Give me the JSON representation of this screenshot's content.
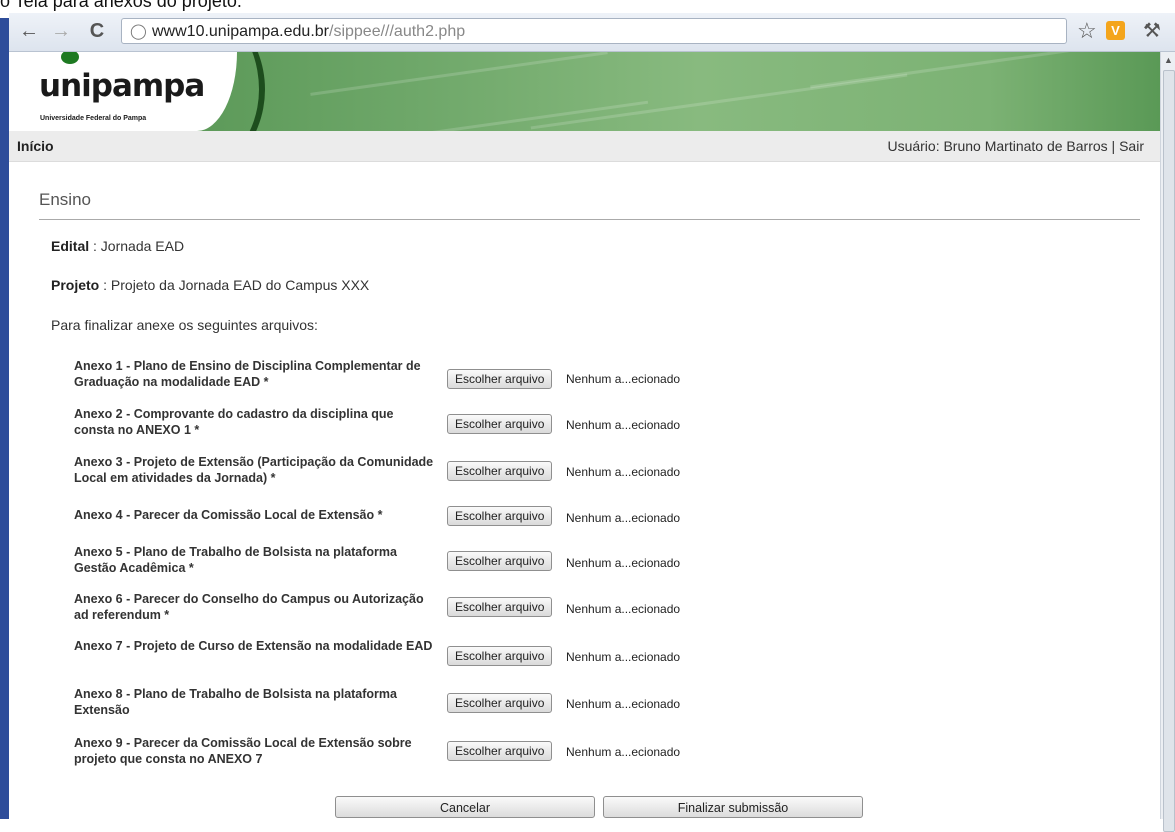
{
  "document": {
    "caption": "o    Tela para anexos do projeto."
  },
  "browser": {
    "back_icon": "back-arrow-icon",
    "forward_icon": "forward-arrow-icon",
    "reload_icon": "reload-icon",
    "url_host": "www10.unipampa.edu.br",
    "url_path": "/sippee///auth2.php",
    "bookmark_icon": "star-icon",
    "extension_icon": "extension-icon",
    "extension_glyph": "V",
    "menu_icon": "wrench-icon"
  },
  "header": {
    "logo_text": "unipampa",
    "logo_subtitle": "Universidade Federal do Pampa"
  },
  "topnav": {
    "home_label": "Início",
    "user_text": "Usuário: Bruno Martinato de Barros | ",
    "logout_label": "Sair"
  },
  "main": {
    "section_title": "Ensino",
    "edital_label": "Edital",
    "edital_value": " : Jornada EAD",
    "projeto_label": "Projeto",
    "projeto_value": " : Projeto da Jornada EAD do Campus XXX",
    "instructions": "Para finalizar anexe os seguintes arquivos:",
    "file_button_label": "Escolher arquivo",
    "annexes": [
      {
        "label": "Anexo 1 - Plano de Ensino de Disciplina Complementar de Graduação na modalidade EAD *",
        "status": "Nenhum a...ecionado"
      },
      {
        "label": "Anexo 2 - Comprovante do cadastro da disciplina que consta no ANEXO 1 *",
        "status": "Nenhum a...ecionado"
      },
      {
        "label": "Anexo 3 - Projeto de Extensão (Participação da Comunidade Local em atividades da Jornada) *",
        "status": "Nenhum a...ecionado"
      },
      {
        "label": "Anexo 4 - Parecer da Comissão Local de Extensão *",
        "status": "Nenhum a...ecionado"
      },
      {
        "label": "Anexo 5 - Plano de Trabalho de Bolsista na plataforma Gestão Acadêmica *",
        "status": "Nenhum a...ecionado"
      },
      {
        "label": "Anexo 6 - Parecer do Conselho do Campus ou Autorização ad referendum *",
        "status": "Nenhum a...ecionado"
      },
      {
        "label": "Anexo 7 - Projeto de Curso de Extensão na modalidade EAD",
        "status": "Nenhum a...ecionado"
      },
      {
        "label": "Anexo 8 - Plano de Trabalho de Bolsista na plataforma Extensão",
        "status": "Nenhum a...ecionado"
      },
      {
        "label": "Anexo 9 - Parecer da Comissão Local de Extensão sobre projeto que consta no ANEXO 7",
        "status": "Nenhum a...ecionado"
      }
    ],
    "cancel_label": "Cancelar",
    "submit_label": "Finalizar submissão"
  },
  "colors": {
    "banner_green": "#6ea769",
    "frame_blue": "#2e4d9a",
    "nav_bar": "#ececec"
  }
}
